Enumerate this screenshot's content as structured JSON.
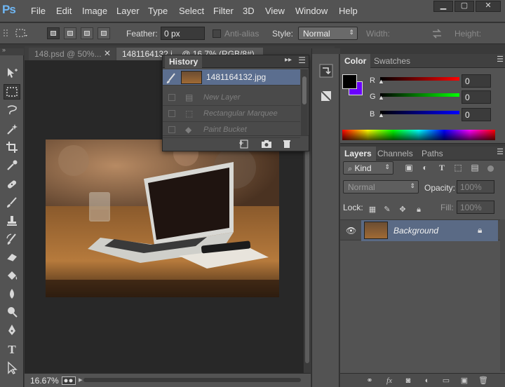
{
  "app": {
    "logo": "Ps"
  },
  "menu": [
    "File",
    "Edit",
    "Image",
    "Layer",
    "Type",
    "Select",
    "Filter",
    "3D",
    "View",
    "Window",
    "Help"
  ],
  "window_controls": {
    "minimize": "▁",
    "maximize": "▢",
    "close": "✕"
  },
  "options": {
    "feather_label": "Feather:",
    "feather_value": "0 px",
    "anti_alias_label": "Anti-alias",
    "style_label": "Style:",
    "style_value": "Normal",
    "width_label": "Width:",
    "height_label": "Height:"
  },
  "tools": [
    "move-tool",
    "marquee-tool",
    "lasso-tool",
    "magic-wand-tool",
    "crop-tool",
    "eyedropper-tool",
    "healing-brush-tool",
    "brush-tool",
    "clone-stamp-tool",
    "history-brush-tool",
    "eraser-tool",
    "paint-bucket-tool",
    "blur-tool",
    "dodge-tool",
    "pen-tool",
    "type-tool",
    "path-selection-tool"
  ],
  "doc_tabs": [
    {
      "label": "148.psd @ 50%...",
      "active": false
    },
    {
      "label": "1481164132.j... @ 16.7% (RGB/8#)",
      "active": true
    }
  ],
  "status": {
    "zoom": "16.67%"
  },
  "history": {
    "title": "History",
    "snapshot": "1481164132.jpg",
    "items": [
      "New Layer",
      "Rectangular Marquee",
      "Paint Bucket"
    ]
  },
  "color_panel": {
    "tabs": [
      "Color",
      "Swatches"
    ],
    "channels": [
      {
        "name": "R",
        "value": "0"
      },
      {
        "name": "G",
        "value": "0"
      },
      {
        "name": "B",
        "value": "0"
      }
    ],
    "foreground": "#000000",
    "background": "#6a00ff"
  },
  "layers_panel": {
    "tabs": [
      "Layers",
      "Channels",
      "Paths"
    ],
    "kind_label": "Kind",
    "blend_mode": "Normal",
    "opacity_label": "Opacity:",
    "opacity_value": "100%",
    "lock_label": "Lock:",
    "fill_label": "Fill:",
    "fill_value": "100%",
    "layers": [
      {
        "name": "Background",
        "visible": true,
        "locked": true
      }
    ]
  }
}
